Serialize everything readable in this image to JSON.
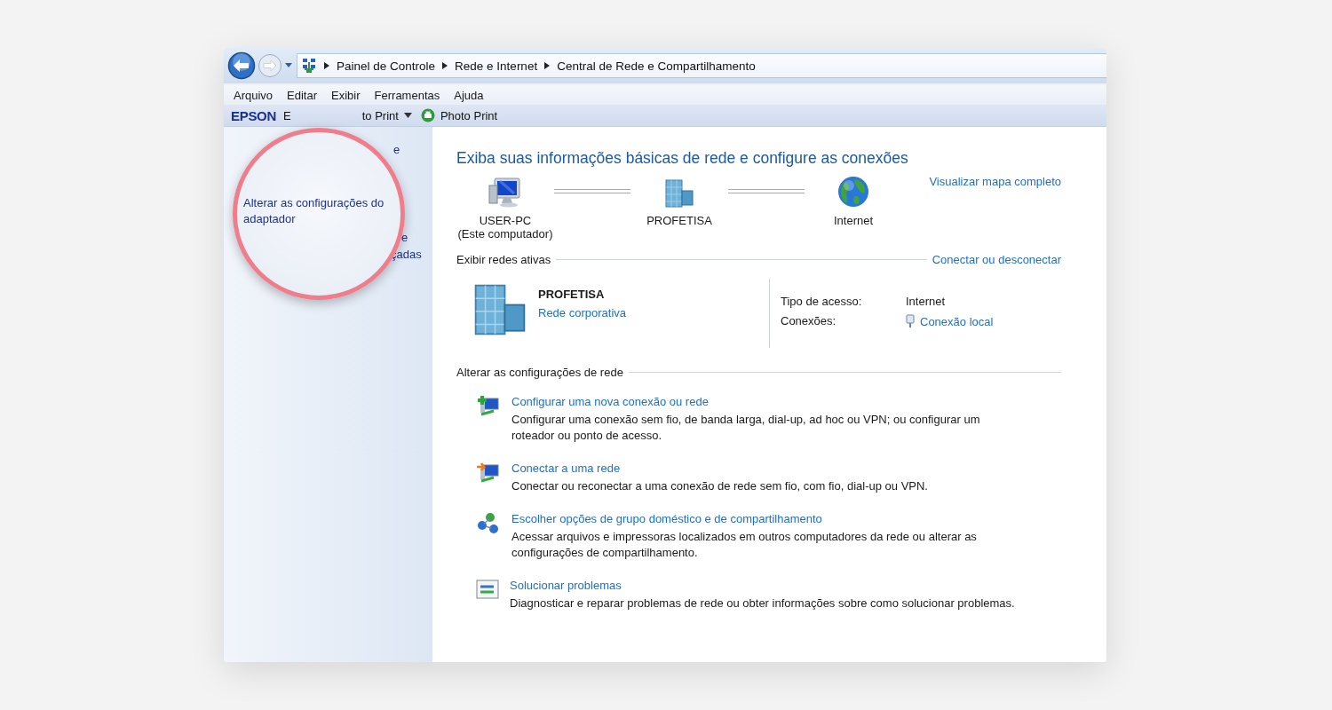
{
  "address_bar": {
    "breadcrumbs": [
      "Painel de Controle",
      "Rede e Internet",
      "Central de Rede e Compartilhamento"
    ]
  },
  "menu_bar": [
    "Arquivo",
    "Editar",
    "Exibir",
    "Ferramentas",
    "Ajuda"
  ],
  "toolbar": {
    "brand": "EPSON",
    "items": [
      {
        "label": "E",
        "kind": "partial"
      },
      {
        "label": "to Print",
        "kind": "menu"
      },
      {
        "label": "Photo Print",
        "kind": "printer"
      }
    ]
  },
  "sidebar": {
    "fragments": [
      "e",
      "e",
      "çadas"
    ]
  },
  "magnifier": {
    "text": "Alterar as configurações do adaptador"
  },
  "content": {
    "heading": "Exiba suas informações básicas de rede e configure as conexões",
    "network_map": {
      "nodes": [
        {
          "kind": "computer",
          "label": "USER-PC",
          "sublabel": "(Este computador)"
        },
        {
          "kind": "network",
          "label": "PROFETISA"
        },
        {
          "kind": "internet",
          "label": "Internet"
        }
      ],
      "link": "Visualizar mapa completo"
    },
    "active_networks": {
      "title": "Exibir redes ativas",
      "link": "Conectar ou desconectar",
      "network": {
        "name": "PROFETISA",
        "type": "Rede corporativa"
      },
      "properties": [
        {
          "label": "Tipo de acesso:",
          "value": "Internet",
          "kind": "text"
        },
        {
          "label": "Conexões:",
          "value": "Conexão local",
          "kind": "link"
        }
      ]
    },
    "change_settings": {
      "title": "Alterar as configurações de rede",
      "tasks": [
        {
          "kind": "new-connection",
          "title": "Configurar uma nova conexão ou rede",
          "description": "Configurar uma conexão sem fio, de banda larga, dial-up, ad hoc ou VPN; ou configurar um roteador ou ponto de acesso."
        },
        {
          "kind": "connect",
          "title": "Conectar a uma rede",
          "description": "Conectar ou reconectar a uma conexão de rede sem fio, com fio, dial-up ou VPN."
        },
        {
          "kind": "homegroup",
          "title": "Escolher opções de grupo doméstico e de compartilhamento",
          "description": "Acessar arquivos e impressoras localizados em outros computadores da rede ou alterar as configurações de compartilhamento."
        },
        {
          "kind": "troubleshoot",
          "title": "Solucionar problemas",
          "description": "Diagnosticar e reparar problemas de rede ou obter informações sobre como solucionar problemas."
        }
      ]
    }
  }
}
